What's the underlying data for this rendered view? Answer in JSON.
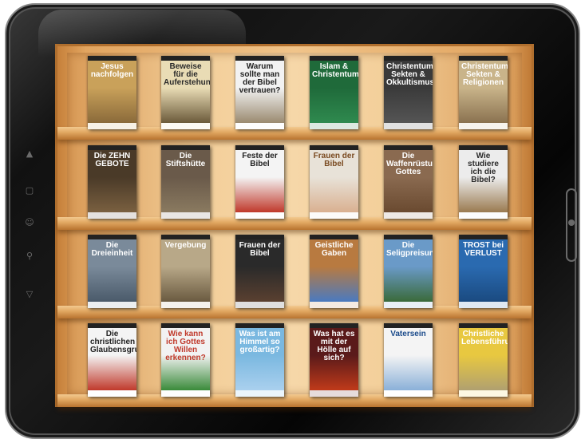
{
  "device": {
    "side_icons": [
      "up-triangle-icon",
      "square-icon",
      "person-icon",
      "search-icon",
      "down-triangle-icon"
    ]
  },
  "shelves": [
    {
      "books": [
        {
          "title": "Jesus nachfolgen",
          "band": "",
          "bg": "#c9a15a",
          "fg": "#ffffff",
          "art": "#8a6a3a"
        },
        {
          "title": "Beweise für die Auferstehung",
          "band": "",
          "bg": "#e9dcb5",
          "fg": "#2a2a2a",
          "art": "#6b5a3a"
        },
        {
          "title": "Warum sollte man der Bibel vertrauen?",
          "band": "",
          "bg": "#f2f2f2",
          "fg": "#222222",
          "art": "#9a8a70"
        },
        {
          "title": "Islam & Christentum",
          "band": "",
          "bg": "#1f6a3a",
          "fg": "#ffffff",
          "art": "#2f8a4f"
        },
        {
          "title": "Christentum, Sekten & Okkultismus",
          "band": "",
          "bg": "#3a3a3a",
          "fg": "#ffffff",
          "art": "#555555"
        },
        {
          "title": "Christentum Sekten & Religionen",
          "band": "",
          "bg": "#c9b48a",
          "fg": "#ffffff",
          "art": "#8a7250"
        }
      ]
    },
    {
      "books": [
        {
          "title": "Die ZEHN GEBOTE",
          "band": "",
          "bg": "#4a3a28",
          "fg": "#ffffff",
          "art": "#7a6040"
        },
        {
          "title": "Die Stiftshütte",
          "band": "",
          "bg": "#6a5a4a",
          "fg": "#ffffff",
          "art": "#8a7a60"
        },
        {
          "title": "Feste der Bibel",
          "band": "",
          "bg": "#f4f4f4",
          "fg": "#222222",
          "art": "#c0392b"
        },
        {
          "title": "Frauen der Bibel",
          "band": "",
          "bg": "#e8e2d8",
          "fg": "#7a4a20",
          "art": "#d9b090"
        },
        {
          "title": "Die Waffenrüstung Gottes",
          "band": "",
          "bg": "#8a6a50",
          "fg": "#ffffff",
          "art": "#6a4a30"
        },
        {
          "title": "Wie studiere ich die Bibel?",
          "band": "",
          "bg": "#ececec",
          "fg": "#2a2a2a",
          "art": "#9a7a50"
        }
      ]
    },
    {
      "books": [
        {
          "title": "Die Dreieinheit",
          "band": "",
          "bg": "#7a8a9a",
          "fg": "#ffffff",
          "art": "#4a5a6a"
        },
        {
          "title": "Vergebung",
          "band": "",
          "bg": "#b8a888",
          "fg": "#ffffff",
          "art": "#6a5a40"
        },
        {
          "title": "Frauen der Bibel",
          "band": "",
          "bg": "#2a2a2a",
          "fg": "#ffffff",
          "art": "#5a4030"
        },
        {
          "title": "Geistliche Gaben",
          "band": "",
          "bg": "#b87a40",
          "fg": "#ffffff",
          "art": "#4a7ac0"
        },
        {
          "title": "Die Seligpreisungen",
          "band": "",
          "bg": "#6a9ac8",
          "fg": "#ffffff",
          "art": "#3a6a3a"
        },
        {
          "title": "TROST bei VERLUST",
          "band": "",
          "bg": "#2a6ab0",
          "fg": "#ffffff",
          "art": "#1a4a80"
        }
      ]
    },
    {
      "books": [
        {
          "title": "Die christlichen Glaubensgrundlagen",
          "band": "",
          "bg": "#f4f4f4",
          "fg": "#222222",
          "art": "#c0392b"
        },
        {
          "title": "Wie kann ich Gottes Willen erkennen?",
          "band": "",
          "bg": "#f2f2f2",
          "fg": "#c0392b",
          "art": "#3a8a3a"
        },
        {
          "title": "Was ist am Himmel so großartig?",
          "band": "",
          "bg": "#7ab8e0",
          "fg": "#ffffff",
          "art": "#aad0ee"
        },
        {
          "title": "Was hat es mit der Hölle auf sich?",
          "band": "",
          "bg": "#5a1a1a",
          "fg": "#ffffff",
          "art": "#c03a1a"
        },
        {
          "title": "Vatersein",
          "band": "",
          "bg": "#f4f4f4",
          "fg": "#1a4a8a",
          "art": "#8ab0d8"
        },
        {
          "title": "Christliche Lebensführung",
          "band": "",
          "bg": "#e8c840",
          "fg": "#ffffff",
          "art": "#b0a070"
        }
      ]
    }
  ]
}
